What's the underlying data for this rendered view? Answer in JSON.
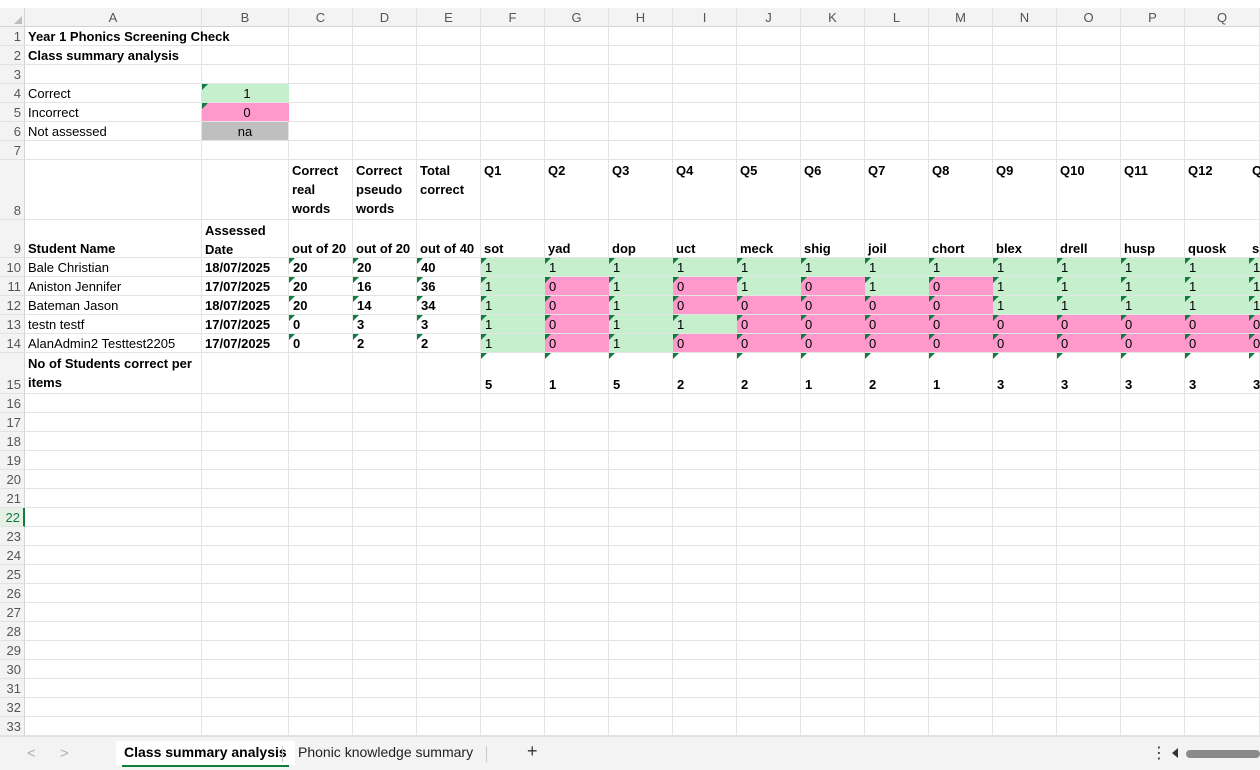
{
  "columns": [
    "A",
    "B",
    "C",
    "D",
    "E",
    "F",
    "G",
    "H",
    "I",
    "J",
    "K",
    "L",
    "M",
    "N",
    "O",
    "P",
    "Q"
  ],
  "rows": [
    "1",
    "2",
    "3",
    "4",
    "5",
    "6",
    "7",
    "8",
    "9",
    "10",
    "11",
    "12",
    "13",
    "14",
    "15",
    "16",
    "17",
    "18",
    "19",
    "20",
    "21",
    "22",
    "23",
    "24",
    "25",
    "26",
    "27",
    "28",
    "29",
    "30",
    "31",
    "32",
    "33"
  ],
  "selected_row": "22",
  "header": {
    "title": "Year 1 Phonics Screening Check",
    "subtitle": "Class summary analysis"
  },
  "legend": [
    {
      "label": "Correct",
      "value": "1",
      "color": "#c6efce"
    },
    {
      "label": "Incorrect",
      "value": "0",
      "color": "#ff99cc"
    },
    {
      "label": "Not assessed",
      "value": "na",
      "color": "#bfbfbf"
    }
  ],
  "col_headers_row8": [
    "Correct real words",
    "Correct pseudo words",
    "Total correct",
    "Q1",
    "Q2",
    "Q3",
    "Q4",
    "Q5",
    "Q6",
    "Q7",
    "Q8",
    "Q9",
    "Q10",
    "Q11",
    "Q12",
    "Q"
  ],
  "row9": {
    "student_name": "Student Name",
    "assessed_date": "Assessed Date",
    "real_out_of": "out of 20",
    "pseudo_out_of": "out of 20",
    "total_out_of": "out of 40",
    "words": [
      "sot",
      "yad",
      "dop",
      "uct",
      "meck",
      "shig",
      "joil",
      "chort",
      "blex",
      "drell",
      "husp",
      "quosk",
      "sl"
    ]
  },
  "students": [
    {
      "name": "Bale Christian",
      "date": "18/07/2025",
      "real": "20",
      "pseudo": "20",
      "total": "40",
      "answers": [
        "1",
        "1",
        "1",
        "1",
        "1",
        "1",
        "1",
        "1",
        "1",
        "1",
        "1",
        "1",
        "1"
      ]
    },
    {
      "name": "Aniston Jennifer",
      "date": "17/07/2025",
      "real": "20",
      "pseudo": "16",
      "total": "36",
      "answers": [
        "1",
        "0",
        "1",
        "0",
        "1",
        "0",
        "1",
        "0",
        "1",
        "1",
        "1",
        "1",
        "1"
      ]
    },
    {
      "name": "Bateman Jason",
      "date": "18/07/2025",
      "real": "20",
      "pseudo": "14",
      "total": "34",
      "answers": [
        "1",
        "0",
        "1",
        "0",
        "0",
        "0",
        "0",
        "0",
        "1",
        "1",
        "1",
        "1",
        "1"
      ]
    },
    {
      "name": "testn testf",
      "date": "17/07/2025",
      "real": "0",
      "pseudo": "3",
      "total": "3",
      "answers": [
        "1",
        "0",
        "1",
        "1",
        "0",
        "0",
        "0",
        "0",
        "0",
        "0",
        "0",
        "0",
        "0"
      ]
    },
    {
      "name": "AlanAdmin2 Testtest2205",
      "date": "17/07/2025",
      "real": "0",
      "pseudo": "2",
      "total": "2",
      "answers": [
        "1",
        "0",
        "1",
        "0",
        "0",
        "0",
        "0",
        "0",
        "0",
        "0",
        "0",
        "0",
        "0"
      ]
    }
  ],
  "summary": {
    "label": "No of Students correct per items",
    "counts": [
      "5",
      "1",
      "5",
      "2",
      "2",
      "1",
      "2",
      "1",
      "3",
      "3",
      "3",
      "3",
      "3"
    ]
  },
  "tabs": [
    {
      "label": "Class summary analysis",
      "active": true
    },
    {
      "label": "Phonic knowledge summary",
      "active": false
    }
  ],
  "icons": {
    "add_sheet": "+",
    "more": "⋮",
    "prev": "<",
    "next": ">"
  },
  "colors": {
    "correct": "#c6efce",
    "incorrect": "#ff99cc",
    "not_assessed": "#bfbfbf",
    "accent": "#107c41"
  }
}
